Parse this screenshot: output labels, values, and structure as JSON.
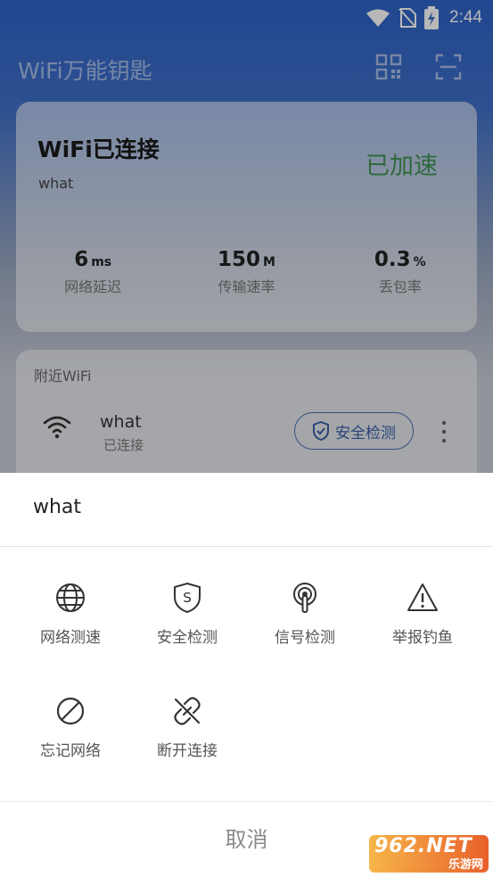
{
  "status_bar": {
    "time": "2:44"
  },
  "app": {
    "title": "WiFi万能钥匙",
    "connection": {
      "title": "WiFi已连接",
      "ssid": "what",
      "accelerated": "已加速",
      "metrics": [
        {
          "value": "6",
          "unit": "ms",
          "label": "网络延迟"
        },
        {
          "value": "150",
          "unit": "M",
          "label": "传输速率"
        },
        {
          "value": "0.3",
          "unit": "%",
          "label": "丢包率"
        }
      ]
    },
    "nearby": {
      "title": "附近WiFi",
      "networks": [
        {
          "name": "what",
          "state": "已连接",
          "action": "安全检测"
        }
      ]
    }
  },
  "sheet": {
    "title": "what",
    "actions": [
      {
        "label": "网络测速",
        "icon": "globe-icon"
      },
      {
        "label": "安全检测",
        "icon": "shield-s-icon"
      },
      {
        "label": "信号检测",
        "icon": "signal-icon"
      },
      {
        "label": "举报钓鱼",
        "icon": "warning-icon"
      },
      {
        "label": "忘记网络",
        "icon": "forbidden-icon"
      },
      {
        "label": "断开连接",
        "icon": "broken-link-icon"
      }
    ],
    "cancel": "取消"
  },
  "watermark": {
    "main": "962.NET",
    "sub": "乐游网"
  },
  "colors": {
    "accent_blue": "#3b5fa8",
    "accel_green": "#2e8b3a"
  }
}
